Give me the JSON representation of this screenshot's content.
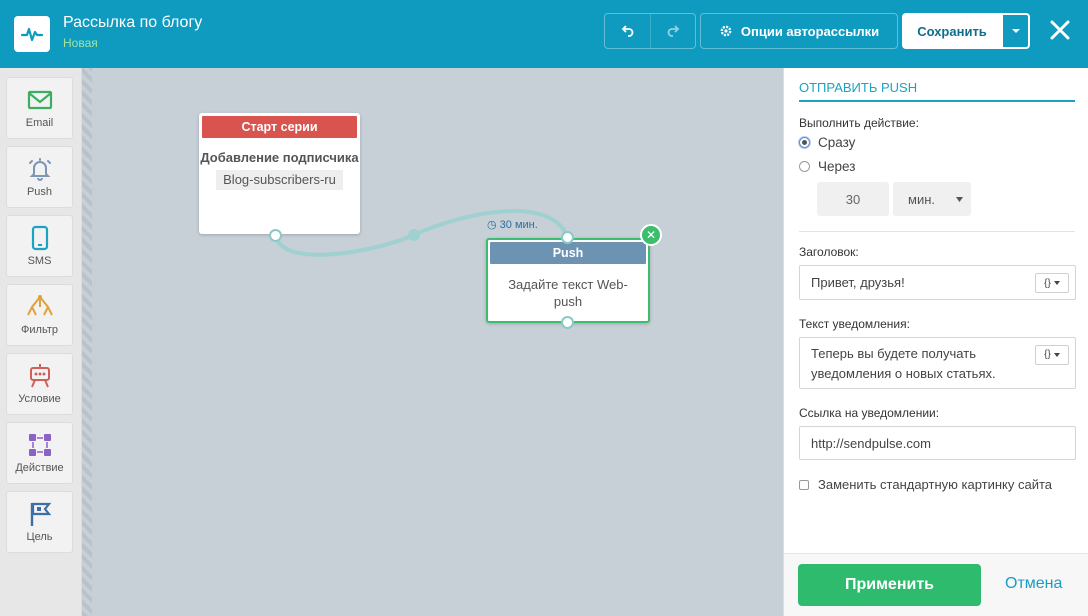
{
  "header": {
    "title": "Рассылка по блогу",
    "subtitle": "Новая",
    "options_label": "Опции авторассылки",
    "save_label": "Сохранить"
  },
  "toolbar": {
    "items": [
      {
        "label": "Email",
        "icon": "envelope-icon"
      },
      {
        "label": "Push",
        "icon": "bell-icon"
      },
      {
        "label": "SMS",
        "icon": "phone-icon"
      },
      {
        "label": "Фильтр",
        "icon": "filter-icon"
      },
      {
        "label": "Условие",
        "icon": "condition-icon"
      },
      {
        "label": "Действие",
        "icon": "action-icon"
      },
      {
        "label": "Цель",
        "icon": "goal-flag-icon"
      }
    ]
  },
  "canvas": {
    "start_node": {
      "header": "Старт серии",
      "title": "Добавление подписчика",
      "tag": "Blog-subscribers-ru"
    },
    "delay_label": "30 мин.",
    "push_node": {
      "header": "Push",
      "body": "Задайте текст Web-push"
    }
  },
  "panel": {
    "title": "ОТПРАВИТЬ PUSH",
    "action_label": "Выполнить действие:",
    "radio_now": "Сразу",
    "radio_after": "Через",
    "delay_value": "30",
    "delay_unit": "мин.",
    "heading_label": "Заголовок:",
    "heading_value": "Привет, друзья!",
    "text_label": "Текст уведомления:",
    "text_value": "Теперь вы будете получать уведомления о новых статьях.",
    "link_label": "Ссылка на уведомлении:",
    "link_value": "http://sendpulse.com",
    "replace_image_label": "Заменить стандартную картинку сайта",
    "apply_label": "Применить",
    "cancel_label": "Отмена"
  },
  "colors": {
    "header_bg": "#0f9bc0",
    "start_header": "#d9534f",
    "push_header": "#6d93b3",
    "accent_green": "#2fbb6e",
    "link_blue": "#1a9cc0"
  }
}
